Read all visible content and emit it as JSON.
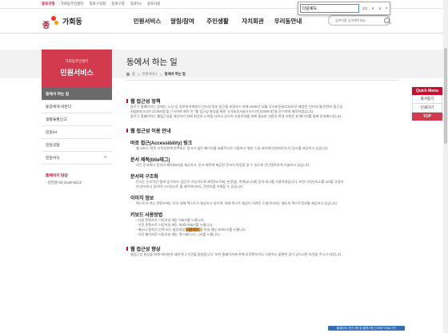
{
  "topbar": [
    "종로구청",
    "가회동주민센터",
    "종로구의회",
    "종로구청",
    "종로TV",
    "종로사랑"
  ],
  "logo_name": "가회동",
  "gnb": [
    "민원서비스",
    "알림/참여",
    "주민생활",
    "자치회관",
    "우리동안내"
  ],
  "search_placeholder": "검색어를 입력해주세요",
  "find": {
    "query": "다운로드",
    "count": "1/1",
    "up": "∧",
    "down": "∨",
    "close": "×"
  },
  "lnb": {
    "sub": "가회동주민센터",
    "title": "민원서비스",
    "items": [
      "동에서 하는 일",
      "동장에게 바란다",
      "생활불편신고",
      "민원24",
      "민원상담",
      "민원서식"
    ],
    "contact_title": "홈페이지 담당",
    "contact_value": "- 김헌숭 02-2148-5213"
  },
  "page_title": "동에서 하는 일",
  "breadcrumb": [
    "홈",
    ">",
    "민원서비스",
    ">",
    "동에서 하는 일"
  ],
  "content": {
    "s1_title": "웹 접근성 정책",
    "s1_p1": "종로구 홈페이지는 장애인, 노인 등 정보취약계층의 인터넷 정보 접근을 보장하기 위해 2005년 12월 국가표준(KICS)으로 제정된 '인터넷 웹 콘텐츠 접근성",
    "s1_p2": "지침(KICS.OT-10.0003)'을 근거하여 제작 된 \"웹 접근성 향상을 위한 국가표준기술가이드라인(2009.3)\"을 준수하여 제작하였습니다.",
    "s1_p3": "종로구 홈페이지는 웹접근성을 개선하기 위해 최선의 노력을 다하고 있으며 사용안내를 위해 필요한 내용과 변경 사항은 본 페이지를 통해 안내해드립니다.",
    "s2_title": "웹 접근성 이용 안내",
    "h_a": "바로 접근(Accessibility) 링크",
    "p_a": "웹 서비스 본문 시작부분에 반복되는 링크가 많은 페이지를 효율적으로 이용하기 위한 스킵 네비게이션(바로가기) 링크를 제공하고 있습니다",
    "h_b": "문서 제목(title태그)",
    "p_b": "모든 문서마다 문서의 제목(title)을 제공하고, 문서 제목에 제공된 문서의 특징을 알 수 있도록 간단명료하게 기술하고 있습니다.",
    "h_c": "문서의 구조화",
    "p_c1": "문서는 논리적인 탭과 및 키보드 접근이 가능하도록 제작(h1~h6), 본문(p), 목록(ul,ol,dl) 등의 태그를 사용하였습니다. 또한 디자인요소를 css를 사용하",
    "p_c2": "여 분리하고 있으며 스타일시트 를 제거하더라도 콘텐츠를 이해할 수 있습니다.",
    "h_d": "이미지 정보",
    "p_d": "텍스트가 아닌 콘텐츠에는 모두 대체 텍스트가 제공되고 있으며, 대체 텍스트 제공이 어려운 도형이미지는 별도의 텍스트정보를 제공하고 있습니다.",
    "h_e": "키보드 사용방법",
    "e1": "- 다음 콘텐츠로 이동하실 때는 Tab키를 누릅니다.",
    "e2": "- 이전 콘텐츠로 이동하실 때는 Shift+Tab키를 누릅니다.",
    "e3a": "- 메뉴나 항목의 선택 또는 첨부파일",
    "e3hl": "다운로드",
    "e3b": "를 하실 때는 Enter키를 누릅니다.",
    "e4": "- 이전 페이지로 이동하실 때는 백스페이스(←)키를 누릅니다.",
    "s3_title": "웹 접근성 향상",
    "s3_p": "웹접근성 향상을 위해 여러분의 제안이나 의견을 환영합니다. 또한 홈페이지에 관해 부정확하거나 사용하시 불편한 점이 있으시면 의견을 주시기 바랍니다."
  },
  "quick": {
    "title": "Quick Menu",
    "items": [
      "즐겨찾기",
      "인쇄하기"
    ],
    "top": "TOP"
  },
  "footer_button": "홈페이지 개선사항 및 불편사항 신고하기 바로가기"
}
